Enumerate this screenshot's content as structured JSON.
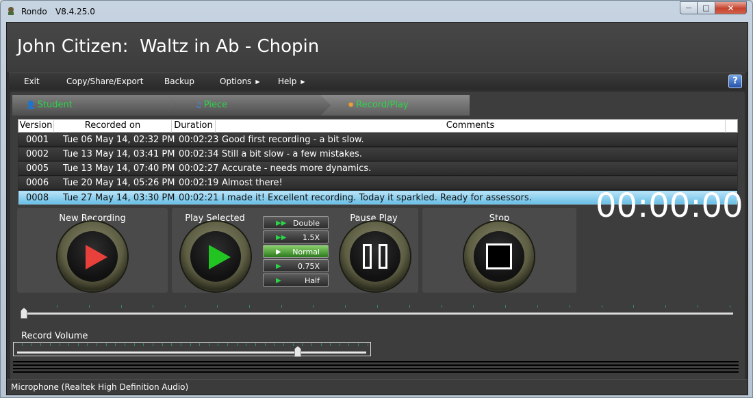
{
  "window": {
    "app_name": "Rondo",
    "version": "V8.4.25.0",
    "controls": {
      "minimize": "—",
      "maximize": "□",
      "close": "✕"
    }
  },
  "header": {
    "title": "John Citizen:  Waltz in Ab - Chopin"
  },
  "menu": {
    "items": [
      {
        "label": "Exit"
      },
      {
        "label": "Copy/Share/Export"
      },
      {
        "label": "Backup"
      },
      {
        "label": "Options",
        "arrow": "▶"
      },
      {
        "label": "Help",
        "arrow": "▶"
      }
    ],
    "help_icon": "?"
  },
  "tabs": [
    {
      "label": "Student",
      "icon": "person-icon",
      "glyph": "👤"
    },
    {
      "label": "Piece",
      "icon": "music-note-icon",
      "glyph": "♫"
    },
    {
      "label": "Record/Play",
      "icon": "gear-icon",
      "glyph": "✹"
    }
  ],
  "table": {
    "columns": [
      "Version",
      "Recorded on",
      "Duration",
      "Comments"
    ],
    "rows": [
      {
        "version": "0001",
        "recorded_on": "Tue 06 May 14, 02:32 PM",
        "duration": "00:02:23",
        "comments": "Good first recording - a bit slow."
      },
      {
        "version": "0002",
        "recorded_on": "Tue 13 May 14, 03:41 PM",
        "duration": "00:02:34",
        "comments": "Still a bit slow - a few mistakes."
      },
      {
        "version": "0005",
        "recorded_on": "Tue 13 May 14, 07:40 PM",
        "duration": "00:02:27",
        "comments": "Accurate - needs more dynamics."
      },
      {
        "version": "0006",
        "recorded_on": "Tue 20 May 14, 05:26 PM",
        "duration": "00:02:19",
        "comments": "Almost there!"
      },
      {
        "version": "0008",
        "recorded_on": "Tue 27 May 14, 03:30 PM",
        "duration": "00:02:21",
        "comments": "I made it! Excellent recording. Today it sparkled. Ready for assessors.",
        "selected": true
      }
    ]
  },
  "controls": {
    "new_recording": "New Recording",
    "play_selected": "Play Selected",
    "pause_play": "Pause Play",
    "stop": "Stop",
    "speeds": [
      {
        "label": "Double",
        "glyph": "▶▶"
      },
      {
        "label": "1.5X",
        "glyph": "▶▶"
      },
      {
        "label": "Normal",
        "glyph": "▶",
        "active": true
      },
      {
        "label": "0.75X",
        "glyph": "▶"
      },
      {
        "label": "Half",
        "glyph": "▶"
      }
    ],
    "record_color": "#e8403a",
    "play_color": "#22c422"
  },
  "timer": "00:00:00",
  "seek": {
    "position": 0
  },
  "volume": {
    "label": "Record Volume",
    "level": 0.82
  },
  "status": {
    "device": "Microphone (Realtek High Definition Audio)"
  }
}
